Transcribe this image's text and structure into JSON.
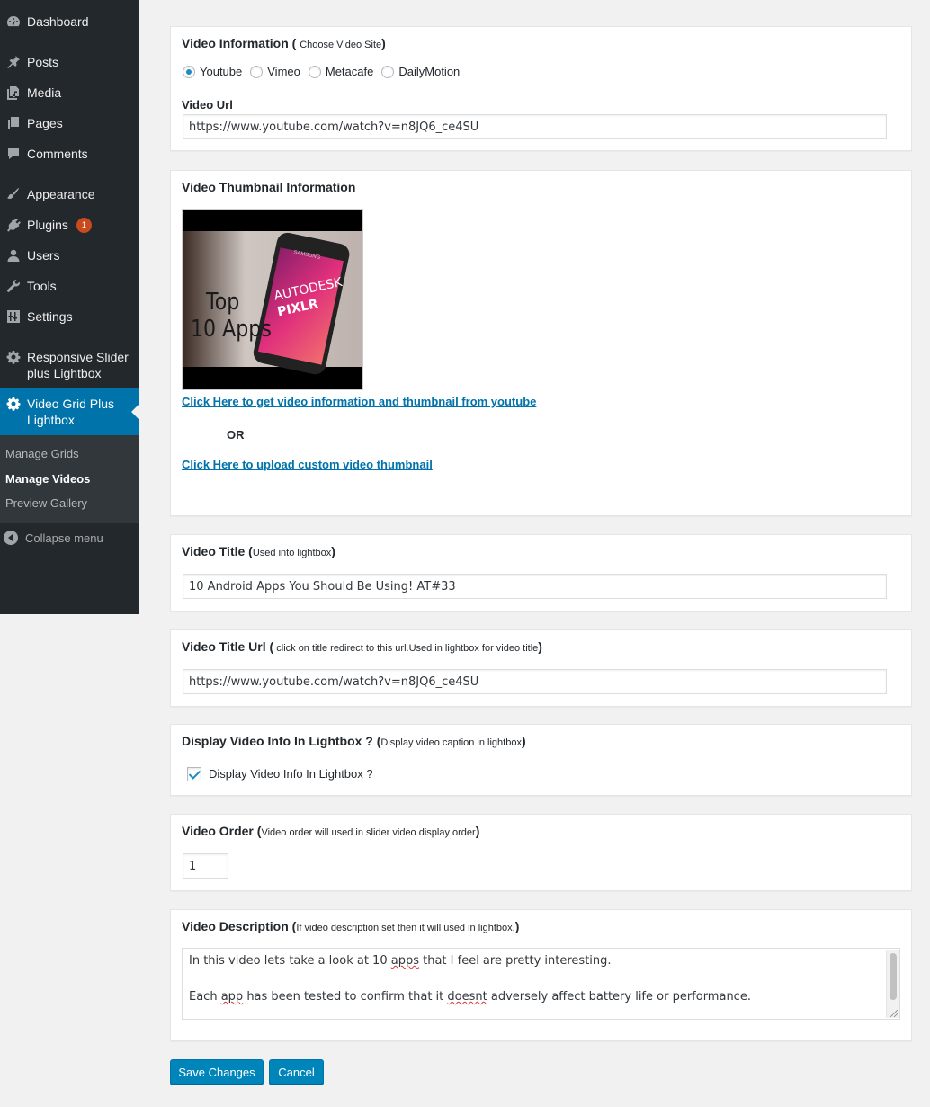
{
  "sidebar": {
    "items": [
      {
        "label": "Dashboard",
        "icon": "dashboard-icon"
      },
      {
        "label": "Posts",
        "icon": "pin-icon"
      },
      {
        "label": "Media",
        "icon": "media-icon"
      },
      {
        "label": "Pages",
        "icon": "pages-icon"
      },
      {
        "label": "Comments",
        "icon": "comment-icon"
      },
      {
        "label": "Appearance",
        "icon": "paintbrush-icon"
      },
      {
        "label": "Plugins",
        "icon": "plugin-icon",
        "badge": "1"
      },
      {
        "label": "Users",
        "icon": "user-icon"
      },
      {
        "label": "Tools",
        "icon": "wrench-icon"
      },
      {
        "label": "Settings",
        "icon": "settings-icon"
      },
      {
        "label": "Responsive Slider plus Lightbox",
        "icon": "gear-icon"
      },
      {
        "label": "Video Grid Plus Lightbox",
        "icon": "gear-icon"
      }
    ],
    "submenu": [
      "Manage Grids",
      "Manage Videos",
      "Preview Gallery"
    ],
    "collapse_label": "Collapse menu"
  },
  "video_info": {
    "title": "Video Information",
    "note": "Choose Video Site",
    "sites": [
      "Youtube",
      "Vimeo",
      "Metacafe",
      "DailyMotion"
    ],
    "selected_site": "Youtube",
    "url_label": "Video Url",
    "url_value": "https://www.youtube.com/watch?v=n8JQ6_ce4SU"
  },
  "thumbnail": {
    "title": "Video Thumbnail Information",
    "thumb_text_line1": "Top",
    "thumb_text_line2": "10 Apps",
    "thumb_brand_line1": "AUTODESK",
    "thumb_brand_line2": "PIXLR",
    "thumb_phone_brand": "SAMSUNG",
    "fetch_link": "Click Here to get video information and thumbnail from youtube ",
    "or_text": "OR",
    "upload_link": "Click Here to upload custom video thumbnail"
  },
  "video_title": {
    "title": "Video Title",
    "note": "Used into lightbox",
    "value": "10 Android Apps You Should Be Using! AT#33"
  },
  "video_title_url": {
    "title": "Video Title Url",
    "note": " click on title redirect to this url.Used in lightbox for video title",
    "value": "https://www.youtube.com/watch?v=n8JQ6_ce4SU"
  },
  "display_info": {
    "title": "Display Video Info In Lightbox ?",
    "note": "Display video caption in lightbox",
    "checkbox_label": "Display Video Info In Lightbox ?",
    "checked": true
  },
  "video_order": {
    "title": "Video Order",
    "note": "Video order will used in slider video display order",
    "value": "1"
  },
  "video_description": {
    "title": "Video Description",
    "note": "If video description set then it will used in lightbox.",
    "line1_a": "In this video lets take a look at 10 ",
    "line1_spell": "apps",
    "line1_b": " that I feel are pretty interesting.",
    "line2_a": "Each ",
    "line2_spell1": "app",
    "line2_b": " has been tested to confirm that it ",
    "line2_spell2": "doesnt",
    "line2_c": " adversely affect battery life or performance."
  },
  "buttons": {
    "save": "Save Changes",
    "cancel": "Cancel"
  },
  "colors": {
    "sidebar_bg": "#23282d",
    "sidebar_current": "#0073aa",
    "primary_button": "#0085ba",
    "link": "#0073aa",
    "badge": "#ca4a1f"
  }
}
